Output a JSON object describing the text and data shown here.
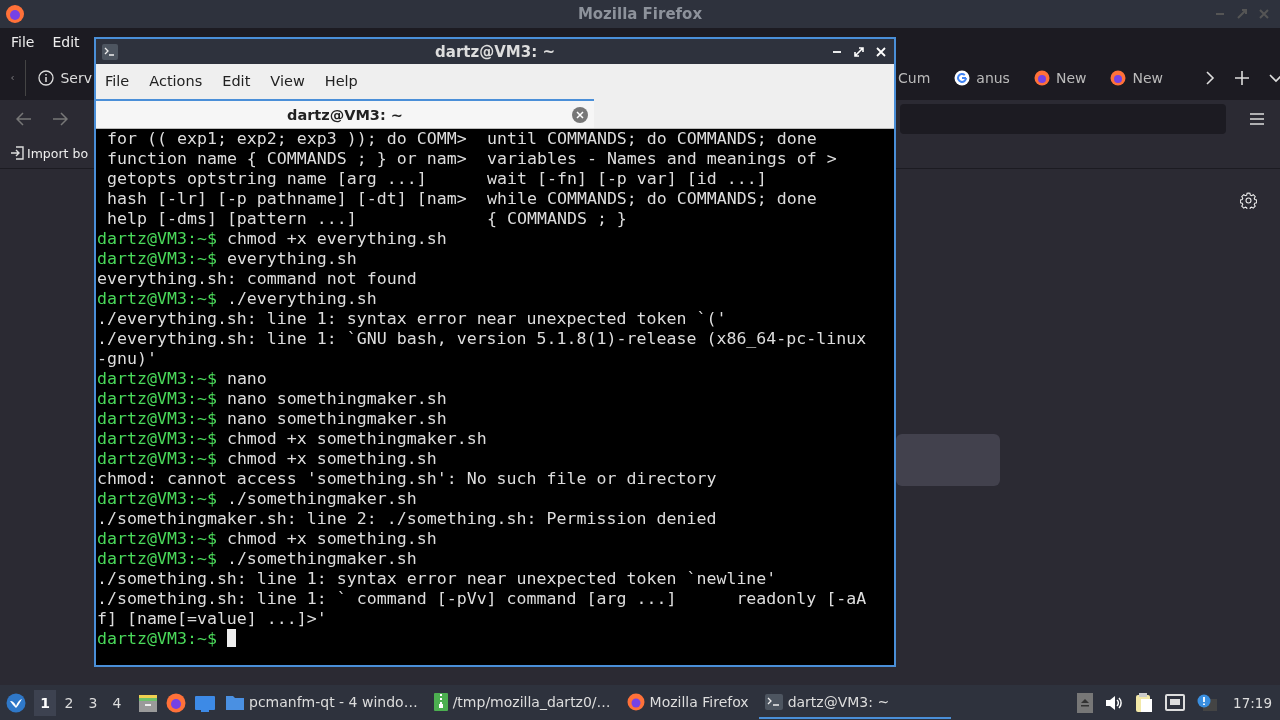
{
  "browser": {
    "title": "Mozilla Firefox",
    "menu": [
      "File",
      "Edit"
    ],
    "tabs": [
      {
        "label": "Serv",
        "kind": "info",
        "selected": false
      },
      {
        "label": "Cum",
        "kind": "plain",
        "selected": false
      },
      {
        "label": "anus",
        "kind": "google",
        "selected": false
      },
      {
        "label": "New",
        "kind": "firefox",
        "selected": false
      },
      {
        "label": "New",
        "kind": "firefox",
        "selected": false
      }
    ],
    "bookmark": "Import bo"
  },
  "terminal": {
    "title": "dartz@VM3: ~",
    "menu": [
      "File",
      "Actions",
      "Edit",
      "View",
      "Help"
    ],
    "tabs": [
      {
        "label": "dartz@VM3: ~",
        "selected": true
      }
    ],
    "help_rows": [
      {
        "left": "for (( exp1; exp2; exp3 )); do COMM>",
        "right": "until COMMANDS; do COMMANDS; done"
      },
      {
        "left": "function name { COMMANDS ; } or nam>",
        "right": "variables - Names and meanings of >"
      },
      {
        "left": "getopts optstring name [arg ...]",
        "right": "wait [-fn] [-p var] [id ...]"
      },
      {
        "left": "hash [-lr] [-p pathname] [-dt] [nam>",
        "right": "while COMMANDS; do COMMANDS; done"
      },
      {
        "left": "help [-dms] [pattern ...]",
        "right": "{ COMMANDS ; }"
      }
    ],
    "lines": [
      {
        "kind": "prompt",
        "prompt": "dartz@VM3:~$",
        "command": "chmod +x everything.sh"
      },
      {
        "kind": "prompt",
        "prompt": "dartz@VM3:~$",
        "command": "everything.sh"
      },
      {
        "kind": "output",
        "text": "everything.sh: command not found"
      },
      {
        "kind": "prompt",
        "prompt": "dartz@VM3:~$",
        "command": "./everything.sh"
      },
      {
        "kind": "output",
        "text": "./everything.sh: line 1: syntax error near unexpected token `('"
      },
      {
        "kind": "output",
        "text": "./everything.sh: line 1: `GNU bash, version 5.1.8(1)-release (x86_64-pc-linux"
      },
      {
        "kind": "output",
        "text": "-gnu)'"
      },
      {
        "kind": "prompt",
        "prompt": "dartz@VM3:~$",
        "command": "nano"
      },
      {
        "kind": "prompt",
        "prompt": "dartz@VM3:~$",
        "command": "nano somethingmaker.sh"
      },
      {
        "kind": "prompt",
        "prompt": "dartz@VM3:~$",
        "command": "nano somethingmaker.sh"
      },
      {
        "kind": "prompt",
        "prompt": "dartz@VM3:~$",
        "command": "chmod +x somethingmaker.sh"
      },
      {
        "kind": "prompt",
        "prompt": "dartz@VM3:~$",
        "command": "chmod +x something.sh"
      },
      {
        "kind": "output",
        "text": "chmod: cannot access 'something.sh': No such file or directory"
      },
      {
        "kind": "prompt",
        "prompt": "dartz@VM3:~$",
        "command": "./somethingmaker.sh"
      },
      {
        "kind": "output",
        "text": "./somethingmaker.sh: line 2: ./something.sh: Permission denied"
      },
      {
        "kind": "prompt",
        "prompt": "dartz@VM3:~$",
        "command": "chmod +x something.sh"
      },
      {
        "kind": "prompt",
        "prompt": "dartz@VM3:~$",
        "command": "./somethingmaker.sh"
      },
      {
        "kind": "output",
        "text": "./something.sh: line 1: syntax error near unexpected token `newline'"
      },
      {
        "kind": "output",
        "text": "./something.sh: line 1: ` command [-pVv] command [arg ...]      readonly [-aA"
      },
      {
        "kind": "output",
        "text": "f] [name[=value] ...]>'"
      },
      {
        "kind": "cursor",
        "prompt": "dartz@VM3:~$"
      }
    ]
  },
  "taskbar": {
    "desktops": [
      {
        "label": "1",
        "selected": true
      },
      {
        "label": "2",
        "selected": false
      },
      {
        "label": "3",
        "selected": false
      },
      {
        "label": "4",
        "selected": false
      }
    ],
    "tasks": [
      {
        "label": "pcmanfm-qt - 4 windo…",
        "kind": "folder",
        "selected": false
      },
      {
        "label": "/tmp/mozilla_dartz0/…",
        "kind": "archive",
        "selected": false
      },
      {
        "label": "Mozilla Firefox",
        "kind": "firefox",
        "selected": false
      },
      {
        "label": "dartz@VM3: ~",
        "kind": "terminal",
        "selected": true
      }
    ],
    "clock": "17:19"
  }
}
